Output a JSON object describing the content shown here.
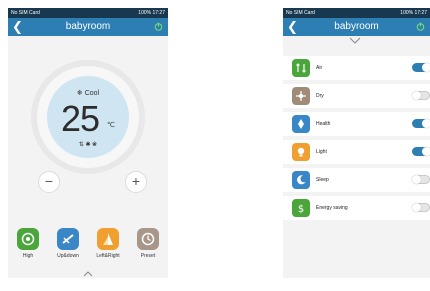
{
  "colors": {
    "header": "#2d7fb3",
    "statusbar": "#17384f",
    "accent": "#2d7fb3",
    "dial": "#cfe5f1"
  },
  "screen1": {
    "statusbar": {
      "left": "No SIM Card",
      "right": "100% 17:27"
    },
    "title": "babyroom",
    "mode": "❄ Cool",
    "temperature": "25",
    "unit": "℃",
    "indicators": "⇅ ✱ ❀",
    "minus": "−",
    "plus": "+",
    "bottom_buttons": [
      {
        "label": "High",
        "icon": "fan-speed-icon",
        "color": "#4aa53b"
      },
      {
        "label": "Up&down",
        "icon": "swing-updown-icon",
        "color": "#3a87c8"
      },
      {
        "label": "Left&Right",
        "icon": "swing-leftright-icon",
        "color": "#f0a030"
      },
      {
        "label": "Preset",
        "icon": "clock-icon",
        "color": "#a8968a"
      }
    ]
  },
  "screen2": {
    "statusbar": {
      "left": "No SIM Card",
      "right": "100% 17:27"
    },
    "title": "babyroom",
    "items": [
      {
        "label": "Air",
        "icon": "air-icon",
        "color": "#4aa53b",
        "on": true
      },
      {
        "label": "Dry",
        "icon": "dry-icon",
        "color": "#a08a78",
        "on": false
      },
      {
        "label": "Health",
        "icon": "health-icon",
        "color": "#3a87c8",
        "on": true
      },
      {
        "label": "Light",
        "icon": "light-icon",
        "color": "#f0a030",
        "on": true
      },
      {
        "label": "Sleep",
        "icon": "sleep-icon",
        "color": "#3a87c8",
        "on": false
      },
      {
        "label": "Energy saving",
        "icon": "energy-saving-icon",
        "color": "#4aa53b",
        "on": false
      }
    ]
  }
}
